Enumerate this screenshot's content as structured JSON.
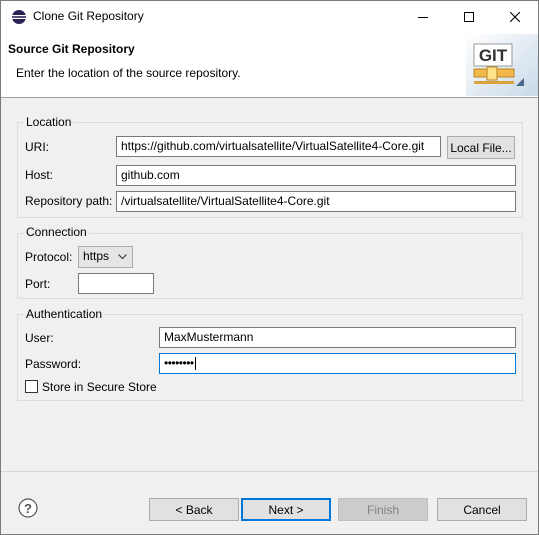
{
  "window": {
    "title": "Clone Git Repository"
  },
  "banner": {
    "title": "Source Git Repository",
    "description": "Enter the location of the source repository.",
    "logo_text": "GIT"
  },
  "location": {
    "group_label": "Location",
    "uri_label": "URI:",
    "uri_value": "https://github.com/virtualsatellite/VirtualSatellite4-Core.git",
    "local_file_button": "Local File...",
    "host_label": "Host:",
    "host_value": "github.com",
    "repo_path_label": "Repository path:",
    "repo_path_value": "/virtualsatellite/VirtualSatellite4-Core.git"
  },
  "connection": {
    "group_label": "Connection",
    "protocol_label": "Protocol:",
    "protocol_value": "https",
    "port_label": "Port:",
    "port_value": ""
  },
  "authentication": {
    "group_label": "Authentication",
    "user_label": "User:",
    "user_value": "MaxMustermann",
    "password_label": "Password:",
    "password_value": "••••••••",
    "store_label": "Store in Secure Store",
    "store_checked": false
  },
  "buttons": {
    "back": "< Back",
    "next": "Next >",
    "finish": "Finish",
    "cancel": "Cancel"
  },
  "icons": {
    "app": "eclipse-icon",
    "help": "help-icon",
    "minimize": "minimize-icon",
    "maximize": "maximize-icon",
    "close": "close-icon"
  }
}
